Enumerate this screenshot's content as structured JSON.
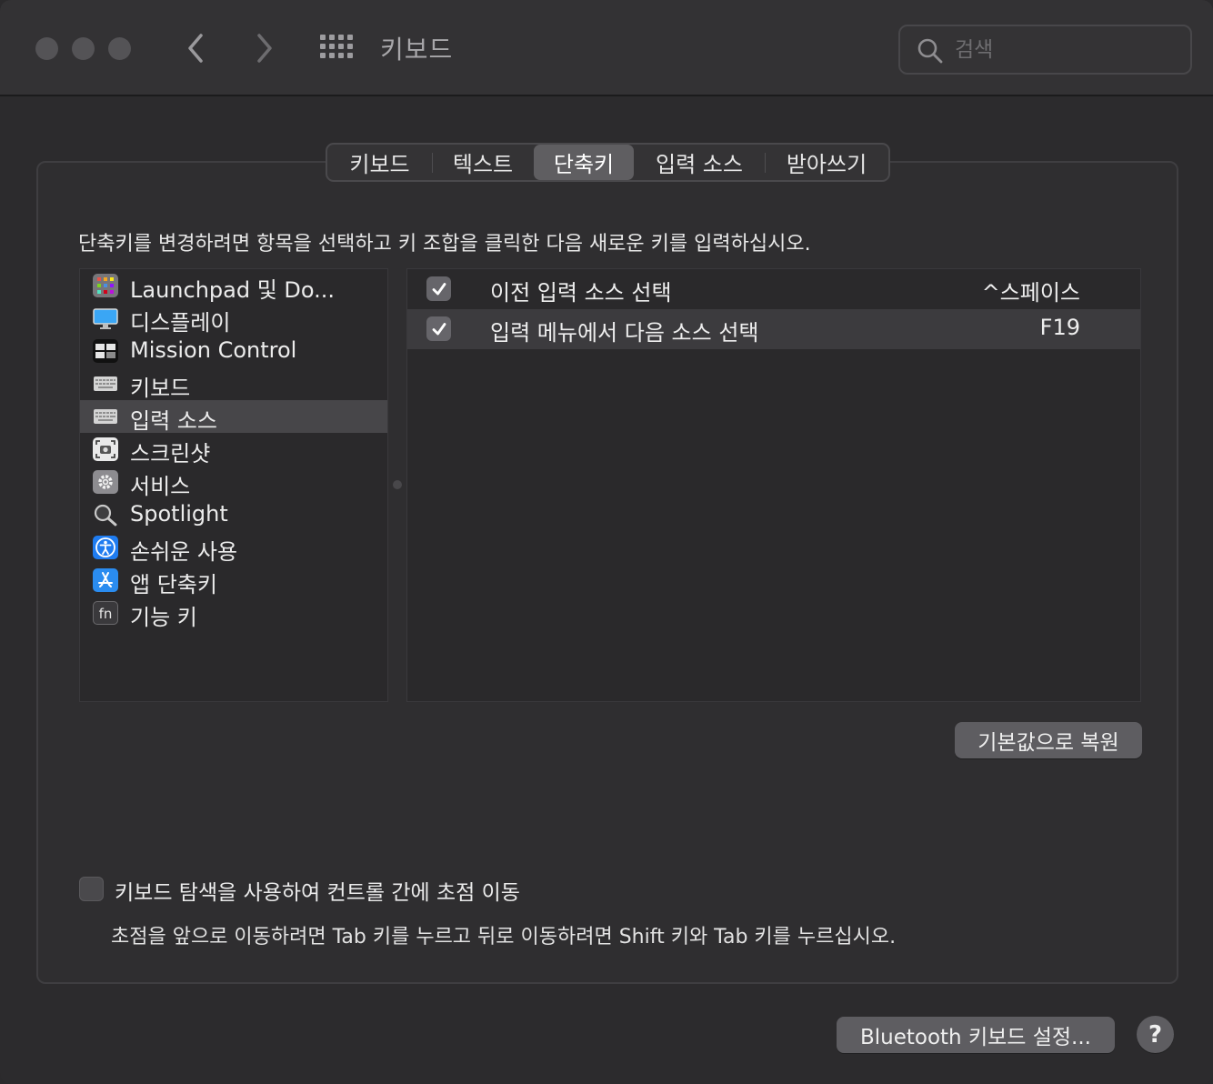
{
  "window": {
    "title": "키보드",
    "search_placeholder": "검색"
  },
  "tabs": [
    {
      "label": "키보드",
      "active": false
    },
    {
      "label": "텍스트",
      "active": false
    },
    {
      "label": "단축키",
      "active": true
    },
    {
      "label": "입력 소스",
      "active": false
    },
    {
      "label": "받아쓰기",
      "active": false
    }
  ],
  "instruction": "단축키를 변경하려면 항목을 선택하고 키 조합을 클릭한 다음 새로운 키를 입력하십시오.",
  "categories": [
    {
      "label": "Launchpad 및 Do...",
      "icon": "launchpad-icon",
      "selected": false
    },
    {
      "label": "디스플레이",
      "icon": "display-icon",
      "selected": false
    },
    {
      "label": "Mission Control",
      "icon": "mission-control-icon",
      "selected": false
    },
    {
      "label": "키보드",
      "icon": "keyboard-icon",
      "selected": false
    },
    {
      "label": "입력 소스",
      "icon": "keyboard-icon",
      "selected": true
    },
    {
      "label": "스크린샷",
      "icon": "screenshot-icon",
      "selected": false
    },
    {
      "label": "서비스",
      "icon": "gear-icon",
      "selected": false
    },
    {
      "label": "Spotlight",
      "icon": "magnifier-icon",
      "selected": false
    },
    {
      "label": "손쉬운 사용",
      "icon": "accessibility-icon",
      "selected": false
    },
    {
      "label": "앱 단축키",
      "icon": "app-store-icon",
      "selected": false
    },
    {
      "label": "기능 키",
      "icon": "fn-key-icon",
      "selected": false
    }
  ],
  "shortcuts": [
    {
      "label": "이전 입력 소스 선택",
      "key": "^스페이스",
      "checked": true
    },
    {
      "label": "입력 메뉴에서 다음 소스 선택",
      "key": "F19",
      "checked": true
    }
  ],
  "buttons": {
    "restore_defaults": "기본값으로 복원",
    "bluetooth": "Bluetooth 키보드 설정...",
    "help": "?"
  },
  "keyboard_navigation": {
    "label": "키보드 탐색을 사용하여 컨트롤 간에 초점 이동",
    "checked": false,
    "hint": "초점을 앞으로 이동하려면 Tab 키를 누르고 뒤로 이동하려면 Shift 키와 Tab 키를 누르십시오."
  },
  "colors": {
    "window_bg": "#2c2b2d",
    "titlebar_bg": "#333234",
    "selection": "#474649",
    "accessibility_blue": "#1f7cf0",
    "app_store_blue": "#2a8cf0"
  }
}
